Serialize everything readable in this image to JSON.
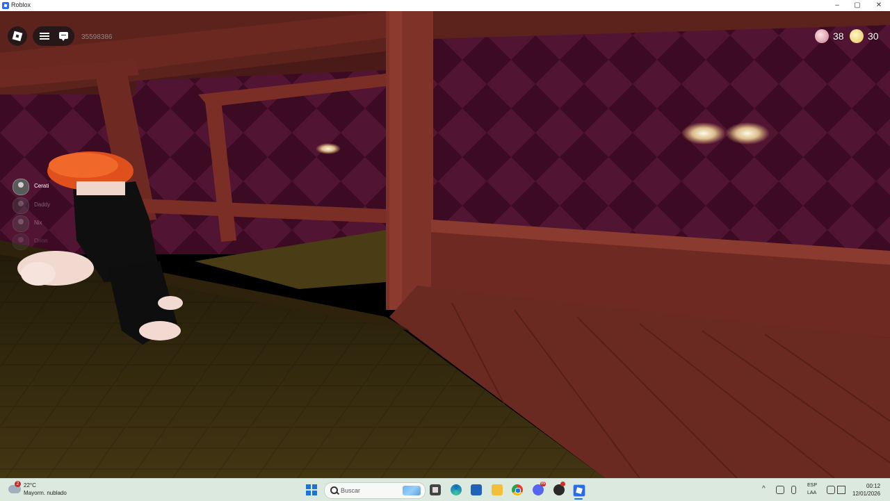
{
  "window": {
    "title": "Roblox",
    "minimize": "–",
    "maximize": "▢",
    "close": "✕"
  },
  "game_hud": {
    "player_id": "35598386",
    "currency": [
      {
        "icon": "candy-icon",
        "value": "38"
      },
      {
        "icon": "gold-coin-icon",
        "value": "30"
      }
    ],
    "players": [
      "Cerati",
      "Daddy",
      "Nix",
      "Orion"
    ]
  },
  "taskbar": {
    "weather_temp": "22°C",
    "weather_desc": "Mayorm. nublado",
    "weather_badge": "2",
    "search_placeholder": "Buscar",
    "discord_badge": "99",
    "lang_1": "ESP",
    "lang_2": "LAA",
    "time": "00:12",
    "date": "12/01/2026",
    "tray_chevron": "^"
  },
  "colors": {
    "wall": "#4a1028",
    "wood": "#7a2e25",
    "floor": "#3b2f10",
    "accent": "#2a6be8"
  }
}
